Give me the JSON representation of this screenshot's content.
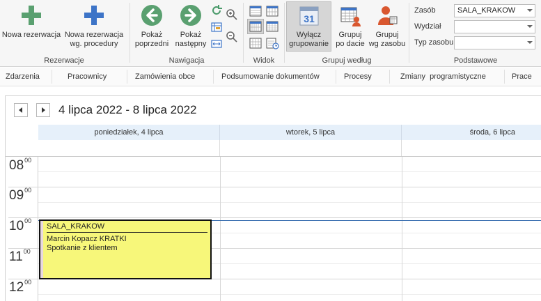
{
  "ribbon": {
    "rezerwacje": {
      "group_label": "Rezerwacje",
      "new_reservation": "Nowa rezerwacja",
      "new_reservation_proc_l1": "Nowa rezerwacja",
      "new_reservation_proc_l2": "wg. procedury"
    },
    "nawigacja": {
      "group_label": "Nawigacja",
      "prev_l1": "Pokaż",
      "prev_l2": "poprzedni",
      "next_l1": "Pokaż",
      "next_l2": "następny"
    },
    "widok": {
      "group_label": "Widok"
    },
    "grupuj": {
      "group_label": "Grupuj według",
      "disable_l1": "Wyłącz",
      "disable_l2": "grupowanie",
      "by_date_l1": "Grupuj",
      "by_date_l2": "po dacie",
      "by_resource_l1": "Grupuj",
      "by_resource_l2": "wg zasobu",
      "calendar_number": "31"
    },
    "podstawowe": {
      "group_label": "Podstawowe",
      "zasob_label": "Zasób",
      "zasob_value": "SALA_KRAKOW",
      "wydzial_label": "Wydział",
      "wydzial_value": "",
      "typ_label": "Typ zasobu",
      "typ_value": ""
    }
  },
  "tabs": [
    "Zdarzenia",
    "Pracownicy",
    "Zamówienia obce",
    "Podsumowanie dokumentów",
    "Procesy",
    "Zmiany  programistyczne",
    "Prace"
  ],
  "calendar": {
    "date_range": "4 lipca 2022 - 8 lipca 2022",
    "days": [
      "poniedziałek, 4 lipca",
      "wtorek, 5 lipca",
      "środa, 6 lipca"
    ],
    "hours": [
      {
        "h": "08",
        "m": "00"
      },
      {
        "h": "09",
        "m": "00"
      },
      {
        "h": "10",
        "m": "00"
      },
      {
        "h": "11",
        "m": "00"
      },
      {
        "h": "12",
        "m": "00"
      }
    ],
    "appointment": {
      "resource": "SALA_KRAKOW",
      "person": "Marcin Kopacz KRATKI",
      "title": "Spotkanie z klientem"
    }
  },
  "colors": {
    "accent_green": "#5aa070",
    "accent_blue": "#3d74c7",
    "appointment_bg": "#f7f77a",
    "day_header_bg": "#e6f0fa",
    "now_line": "#3a6fb0"
  }
}
